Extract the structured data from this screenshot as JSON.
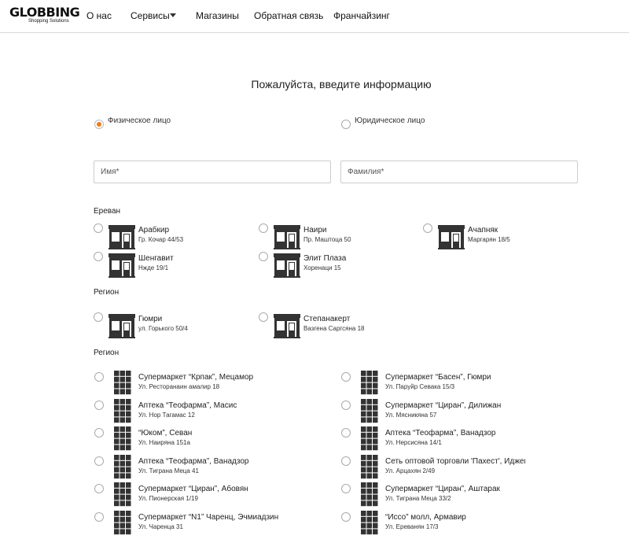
{
  "header": {
    "logo_main": "GLOBBING",
    "logo_sub": "Shopping Solutions",
    "nav": [
      "О нас",
      "Сервисы",
      "Магазины",
      "Обратная связь",
      "Франчайзинг"
    ]
  },
  "form": {
    "title": "Пожалуйста, введите информацию",
    "person_type": {
      "individual": "Физическое лицо",
      "legal": "Юридическое лицо",
      "selected": "individual"
    },
    "first_name_placeholder": "Имя*",
    "last_name_placeholder": "Фамилия*"
  },
  "sections": {
    "yerevan": {
      "title": "Ереван",
      "stores": [
        {
          "name": "Арабкир",
          "address": "Гр. Кочар 44/53"
        },
        {
          "name": "Наири",
          "address": "Пр. Маштоца 50"
        },
        {
          "name": "Ачапняк",
          "address": "Маргарян 18/5"
        },
        {
          "name": "Шенгавит",
          "address": "Нжде 19/1"
        },
        {
          "name": "Элит Плаза",
          "address": "Хоренаци 15"
        }
      ]
    },
    "region1": {
      "title": "Регион",
      "stores": [
        {
          "name": "Гюмри",
          "address": "ул. Горького 50/4"
        },
        {
          "name": "Степанакерт",
          "address": "Вазгена Саргсяна 18"
        }
      ]
    },
    "region2": {
      "title": "Регион",
      "left": [
        {
          "name": "Супермаркет “Крпак”, Мецамор",
          "address": "Ул. Ресторанаин амалир 18"
        },
        {
          "name": "Аптека “Теофарма”, Масис",
          "address": "Ул. Нор Тагамас 12"
        },
        {
          "name": "“Юком”, Севан",
          "address": "Ул. Наиряна 151а"
        },
        {
          "name": "Аптека “Теофарма”, Ванадзор",
          "address": "Ул. Тиграна Меца 41"
        },
        {
          "name": "Супермаркет “Циран”, Абовян",
          "address": "Ул. Пионерская 1/19"
        },
        {
          "name": "Супермаркет “N1” Чаренц, Эчмиадзин",
          "address": "Ул. Чаренца 31"
        }
      ],
      "right": [
        {
          "name": "Супермаркет “Басен”, Гюмри",
          "address": "Ул. Паруйр Севака 15/3"
        },
        {
          "name": "Супермаркет “Циран”, Дилижан",
          "address": "Ул. Мясникяна 57"
        },
        {
          "name": "Аптека “Теофарма”, Ванадзор",
          "address": "Ул. Нерсисяна 14/1"
        },
        {
          "name": "Сеть оптовой торговли 'Пахест', Иджев",
          "address": "Ул. Арцахян 2/49"
        },
        {
          "name": "Супермаркет “Циран”, Аштарак",
          "address": "Ул. Тиграна Меца 33/2"
        },
        {
          "name": "“Иссо” молл, Армавир",
          "address": "Ул. Ереванян 17/3"
        }
      ]
    }
  },
  "colors": {
    "accent": "#f07b1a",
    "icon": "#333333"
  }
}
